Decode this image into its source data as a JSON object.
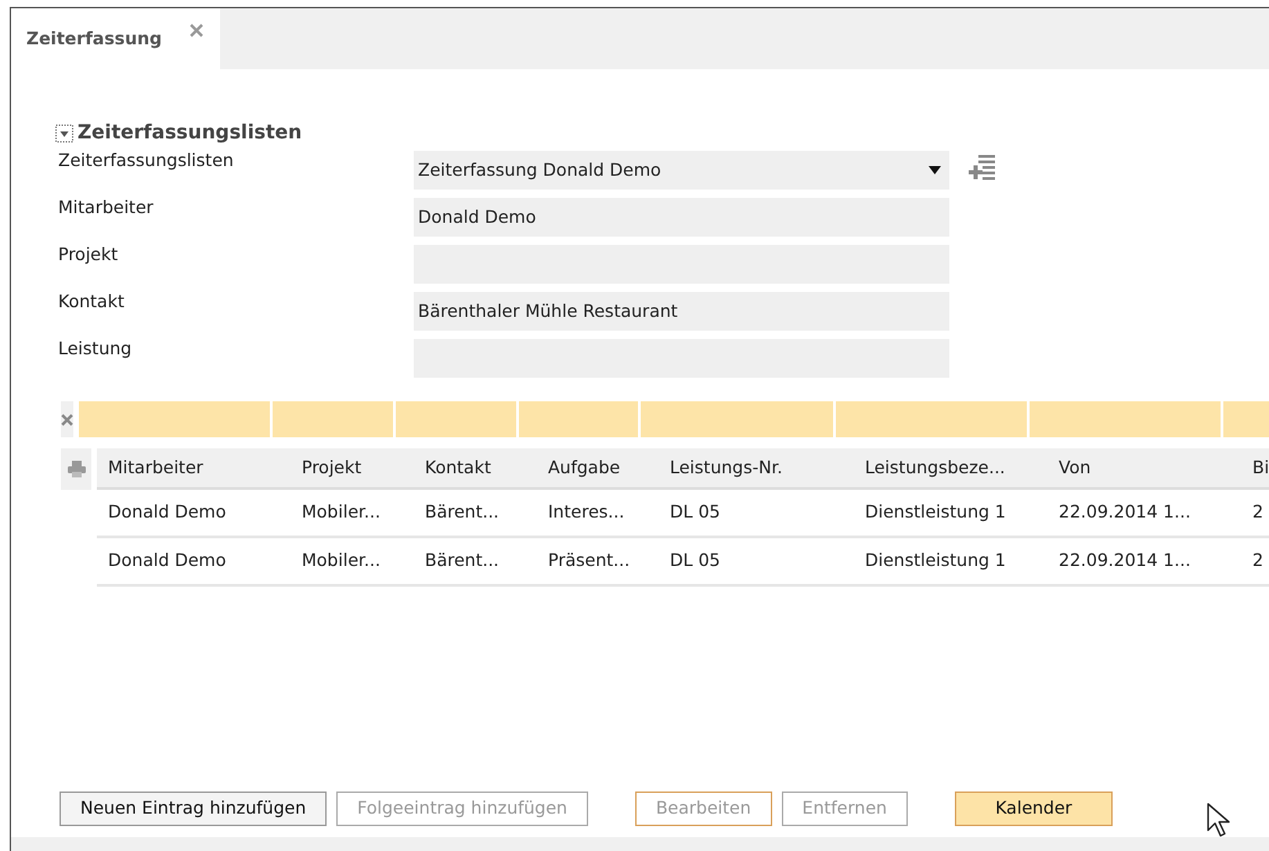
{
  "tabs": [
    {
      "label": "Zeiterfassung",
      "selected": true
    }
  ],
  "section": {
    "title": "Zeiterfassungslisten",
    "expanded": true
  },
  "form": [
    {
      "label": "Zeiterfassungslisten",
      "value": "Zeiterfassung Donald Demo",
      "kind": "dropdown"
    },
    {
      "label": "Mitarbeiter",
      "value": "Donald Demo",
      "kind": "text"
    },
    {
      "label": "Projekt",
      "kind": "text"
    },
    {
      "label": "Kontakt",
      "value": "Bärenthaler Mühle Restaurant",
      "kind": "text"
    },
    {
      "label": "Leistung",
      "kind": "text"
    }
  ],
  "table": {
    "columns": [
      "Mitarbeiter",
      "Projekt",
      "Kontakt",
      "Aufgabe",
      "Leistungs-Nr.",
      "Leistungsbeze...",
      "Von",
      "Bi"
    ],
    "rows": [
      [
        "Donald Demo",
        "Mobiler...",
        "Bärent...",
        "Interes...",
        "DL 05",
        "Dienstleistung 1",
        "22.09.2014 1...",
        "2"
      ],
      [
        "Donald Demo",
        "Mobiler...",
        "Bärent...",
        "Präsent...",
        "DL 05",
        "Dienstleistung 1",
        "22.09.2014 1...",
        "2"
      ]
    ]
  },
  "buttons": [
    {
      "label": "Neuen Eintrag hinzufügen",
      "disabled": false,
      "kind": "normal"
    },
    {
      "label": "Folgeeintrag hinzufügen",
      "disabled": true,
      "kind": "normal"
    },
    {
      "label": "Bearbeiten",
      "disabled": true,
      "kind": "accent"
    },
    {
      "label": "Entfernen",
      "disabled": true,
      "kind": "normal"
    },
    {
      "label": "Kalender",
      "disabled": false,
      "kind": "primary"
    }
  ]
}
